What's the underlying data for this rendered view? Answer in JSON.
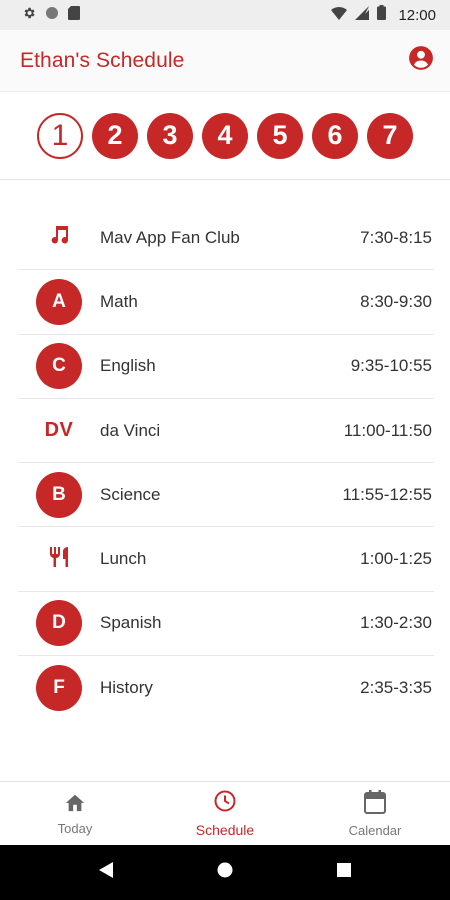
{
  "status_bar": {
    "time": "12:00"
  },
  "header": {
    "title": "Ethan's Schedule"
  },
  "days": [
    "1",
    "2",
    "3",
    "4",
    "5",
    "6",
    "7"
  ],
  "selected_day": "1",
  "schedule": [
    {
      "badge": "music-note-icon",
      "name": "Mav App Fan Club",
      "time": "7:30-8:15"
    },
    {
      "badge": "A",
      "name": "Math",
      "time": "8:30-9:30"
    },
    {
      "badge": "C",
      "name": "English",
      "time": "9:35-10:55"
    },
    {
      "badge": "DV",
      "name": "da Vinci",
      "time": "11:00-11:50"
    },
    {
      "badge": "B",
      "name": "Science",
      "time": "11:55-12:55"
    },
    {
      "badge": "fork-knife-icon",
      "name": "Lunch",
      "time": "1:00-1:25"
    },
    {
      "badge": "D",
      "name": "Spanish",
      "time": "1:30-2:30"
    },
    {
      "badge": "F",
      "name": "History",
      "time": "2:35-3:35"
    }
  ],
  "bottom_nav": {
    "today": "Today",
    "schedule": "Schedule",
    "calendar": "Calendar",
    "active": "schedule"
  },
  "colors": {
    "accent": "#c62828",
    "text": "#333333",
    "muted": "#777777"
  }
}
